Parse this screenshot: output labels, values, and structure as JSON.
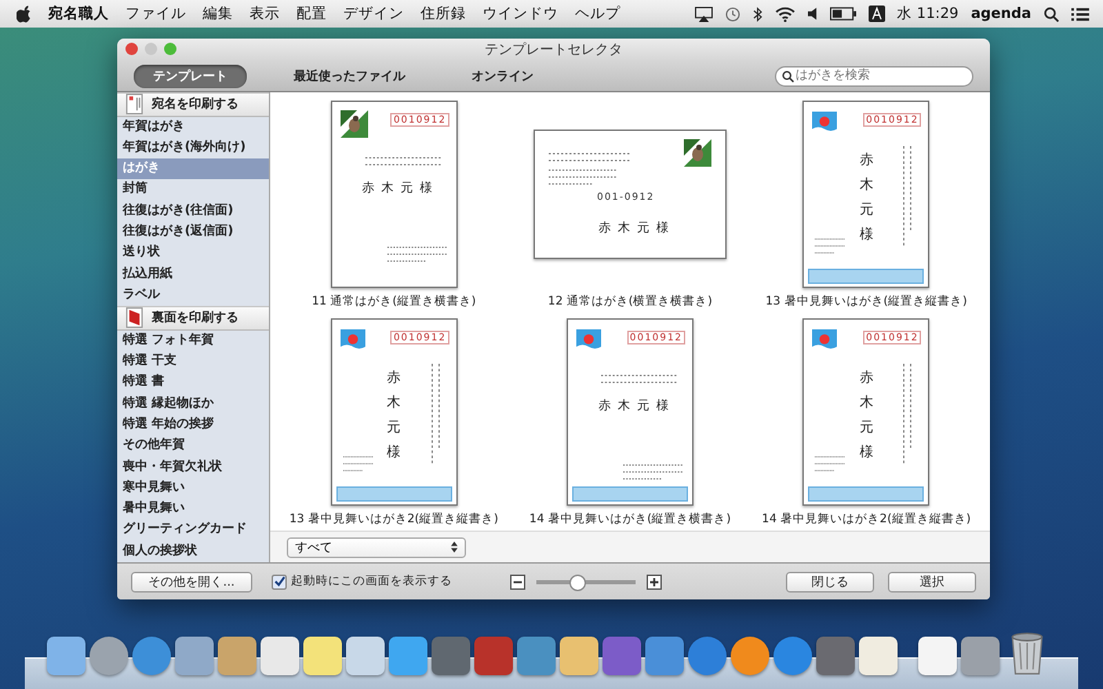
{
  "menu_bar": {
    "app_name": "宛名職人",
    "menus": [
      "ファイル",
      "編集",
      "表示",
      "配置",
      "デザイン",
      "住所録",
      "ウインドウ",
      "ヘルプ"
    ],
    "clock": "水 11:29",
    "user": "agenda"
  },
  "window": {
    "title": "テンプレートセレクタ"
  },
  "tabs": [
    {
      "label": "テンプレート",
      "selected": true
    },
    {
      "label": "最近使ったファイル",
      "selected": false
    },
    {
      "label": "オンライン",
      "selected": false
    }
  ],
  "search": {
    "placeholder": "はがきを検索"
  },
  "sidebar": {
    "groups": [
      {
        "header": "宛名を印刷する",
        "kind": "address",
        "items": [
          {
            "label": "年賀はがき",
            "selected": false
          },
          {
            "label": "年賀はがき(海外向け)",
            "selected": false
          },
          {
            "label": "はがき",
            "selected": true
          },
          {
            "label": "封筒",
            "selected": false
          },
          {
            "label": "往復はがき(往信面)",
            "selected": false
          },
          {
            "label": "往復はがき(返信面)",
            "selected": false
          },
          {
            "label": "送り状",
            "selected": false
          },
          {
            "label": "払込用紙",
            "selected": false
          },
          {
            "label": "ラベル",
            "selected": false
          }
        ]
      },
      {
        "header": "裏面を印刷する",
        "kind": "back",
        "items": [
          {
            "label": "特選 フォト年賀",
            "selected": false
          },
          {
            "label": "特選 干支",
            "selected": false
          },
          {
            "label": "特選 書",
            "selected": false
          },
          {
            "label": "特選 縁起物ほか",
            "selected": false
          },
          {
            "label": "特選 年始の挨拶",
            "selected": false
          },
          {
            "label": "その他年賀",
            "selected": false
          },
          {
            "label": "喪中・年賀欠礼状",
            "selected": false
          },
          {
            "label": "寒中見舞い",
            "selected": false
          },
          {
            "label": "暑中見舞い",
            "selected": false
          },
          {
            "label": "グリーティングカード",
            "selected": false
          },
          {
            "label": "個人の挨拶状",
            "selected": false
          }
        ]
      }
    ]
  },
  "templates": [
    {
      "caption": "11 通常はがき(縦置き横書き)",
      "kind": "portrait-horizontal",
      "stamp": {
        "kind": "bird"
      },
      "postal_code": "0010912",
      "recipient": "赤木元様"
    },
    {
      "caption": "12 通常はがき(横置き横書き)",
      "kind": "landscape",
      "stamp": {
        "kind": "bird"
      },
      "postal_code": "001-0912",
      "recipient": "赤木元様"
    },
    {
      "caption": "13 暑中見舞いはがき(縦置き縦書き)",
      "kind": "portrait-vertical",
      "stamp": {
        "kind": "sun"
      },
      "postal_code": "0010912",
      "recipient": "赤木元様"
    },
    {
      "caption": "13 暑中見舞いはがき2(縦置き縦書き)",
      "kind": "portrait-vertical",
      "stamp": {
        "kind": "sun"
      },
      "postal_code": "0010912",
      "recipient": "赤木元様"
    },
    {
      "caption": "14 暑中見舞いはがき(縦置き横書き)",
      "kind": "portrait-horizontal",
      "stamp": {
        "kind": "sun"
      },
      "postal_code": "0010912",
      "recipient": "赤木元様"
    },
    {
      "caption": "14 暑中見舞いはがき2(縦置き縦書き)",
      "kind": "portrait-vertical",
      "stamp": {
        "kind": "sun"
      },
      "postal_code": "0010912",
      "recipient": "赤木元様"
    }
  ],
  "filter": {
    "value": "すべて"
  },
  "bottom_bar": {
    "other_button": "その他を開く...",
    "startup_checkbox": {
      "label": "起動時にこの画面を表示する",
      "checked": true
    },
    "zoom": {
      "level": 0.4
    },
    "buttons": [
      "閉じる",
      "選択"
    ]
  }
}
